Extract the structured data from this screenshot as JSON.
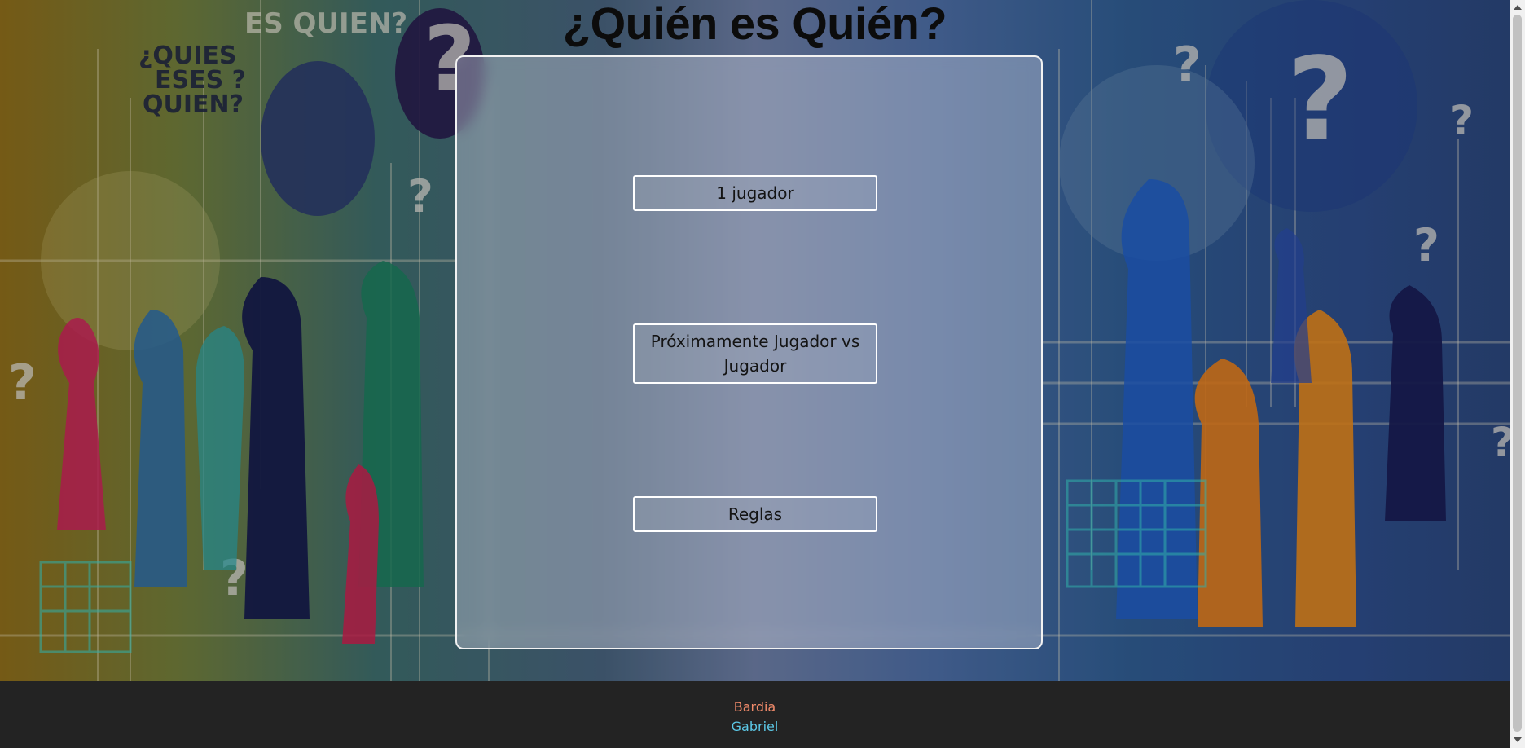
{
  "game": {
    "title": "¿Quién es Quién?"
  },
  "background": {
    "art_texts": [
      "¿QUIEN ES QUIEN?",
      "ES QUIEN?",
      "?"
    ]
  },
  "menu": {
    "single_player": "1 jugador",
    "player_vs_player": "Próximamente Jugador vs Jugador",
    "rules": "Reglas"
  },
  "footer": {
    "credits": [
      {
        "name": "Bardia",
        "color": "#f08a6a"
      },
      {
        "name": "Gabriel",
        "color": "#5cc8e6"
      }
    ]
  },
  "colors": {
    "footer_bg": "#232323",
    "title": "#0c0c0c",
    "panel_border": "#f2f2f2"
  }
}
